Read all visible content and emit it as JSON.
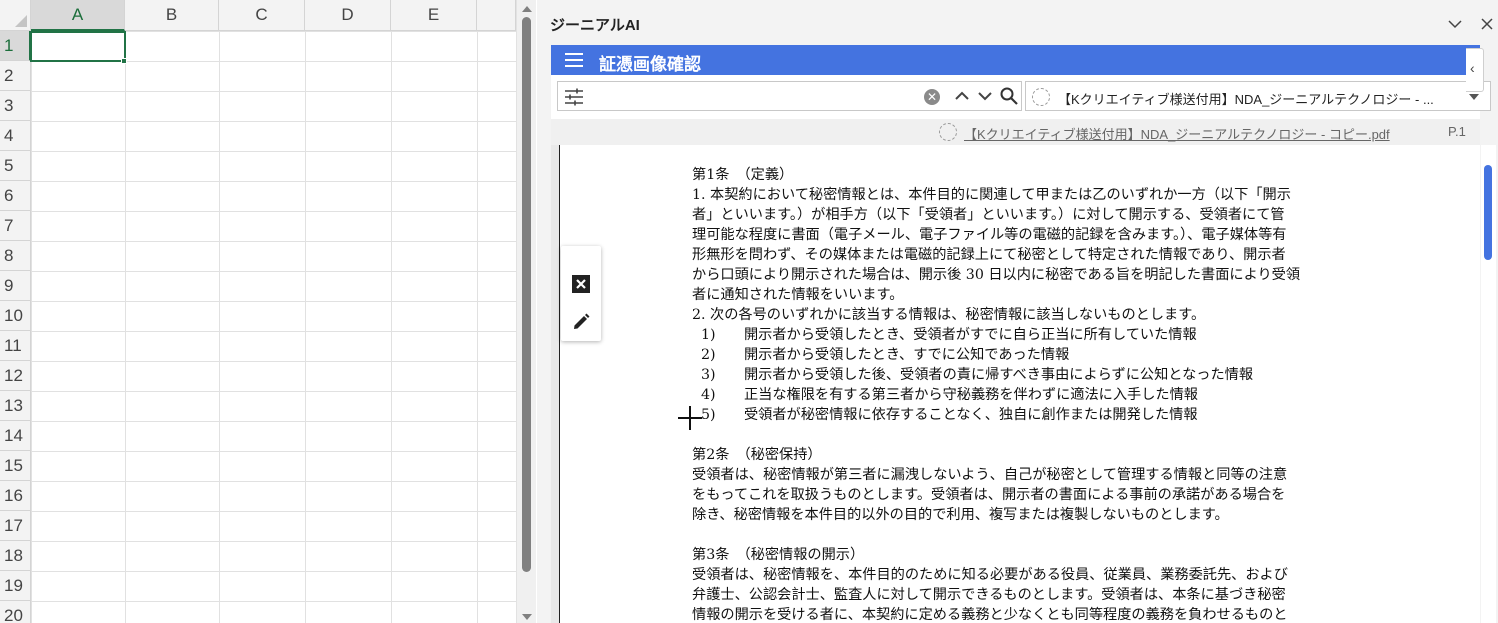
{
  "sheet": {
    "columns": [
      "A",
      "B",
      "C",
      "D",
      "E"
    ],
    "rows": [
      "1",
      "2",
      "3",
      "4",
      "5",
      "6",
      "7",
      "8",
      "9",
      "10",
      "11",
      "12",
      "13",
      "14",
      "15",
      "16",
      "17",
      "18",
      "19",
      "20"
    ],
    "active_cell": "A1"
  },
  "pane": {
    "title": "ジーニアルAI",
    "app_title": "証憑画像確認",
    "search": {
      "value": ""
    },
    "doc_select": "【Kクリエイティブ様送付用】NDA_ジーニアルテクノロジー - ...",
    "file_link": "【Kクリエイティブ様送付用】NDA_ジーニアルテクノロジー - コピー.pdf",
    "file_page": "P.1",
    "side_tab": "‹"
  },
  "document": {
    "lines": [
      "第1条　（定義）",
      "1. 本契約において秘密情報とは、本件目的に関連して甲または乙のいずれか一方（以下「開示",
      "者」といいます。）が相手方（以下「受領者」といいます。）に対して開示する、受領者にて管",
      "理可能な程度に書面（電子メール、電子ファイル等の電磁的記録を含みます。）、電子媒体等有",
      "形無形を問わず、その媒体または電磁的記録上にて秘密として特定された情報であり、開示者",
      "から口頭により開示された場合は、開示後 30 日以内に秘密である旨を明記した書面により受領",
      "者に通知された情報をいいます。",
      "2. 次の各号のいずれかに該当する情報は、秘密情報に該当しないものとします。",
      "  1)　　開示者から受領したとき、受領者がすでに自ら正当に所有していた情報",
      "  2)　　開示者から受領したとき、すでに公知であった情報",
      "  3)　　開示者から受領した後、受領者の責に帰すべき事由によらずに公知となった情報",
      "  4)　　正当な権限を有する第三者から守秘義務を伴わずに適法に入手した情報",
      "  5)　　受領者が秘密情報に依存することなく、独自に創作または開発した情報",
      "",
      "第2条　（秘密保持）",
      "受領者は、秘密情報が第三者に漏洩しないよう、自己が秘密として管理する情報と同等の注意",
      "をもってこれを取扱うものとします。受領者は、開示者の書面による事前の承諾がある場合を",
      "除き、秘密情報を本件目的以外の目的で利用、複写または複製しないものとします。",
      "",
      "第3条　（秘密情報の開示）",
      "受領者は、秘密情報を、本件目的のために知る必要がある役員、従業員、業務委託先、および",
      "弁護士、公認会計士、監査人に対して開示できるものとします。受領者は、本条に基づき秘密",
      "情報の開示を受ける者に、本契約に定める義務と少なくとも同等程度の義務を負わせるものと"
    ]
  },
  "colors": {
    "accent": "#4473e0",
    "excel_green": "#217346"
  }
}
